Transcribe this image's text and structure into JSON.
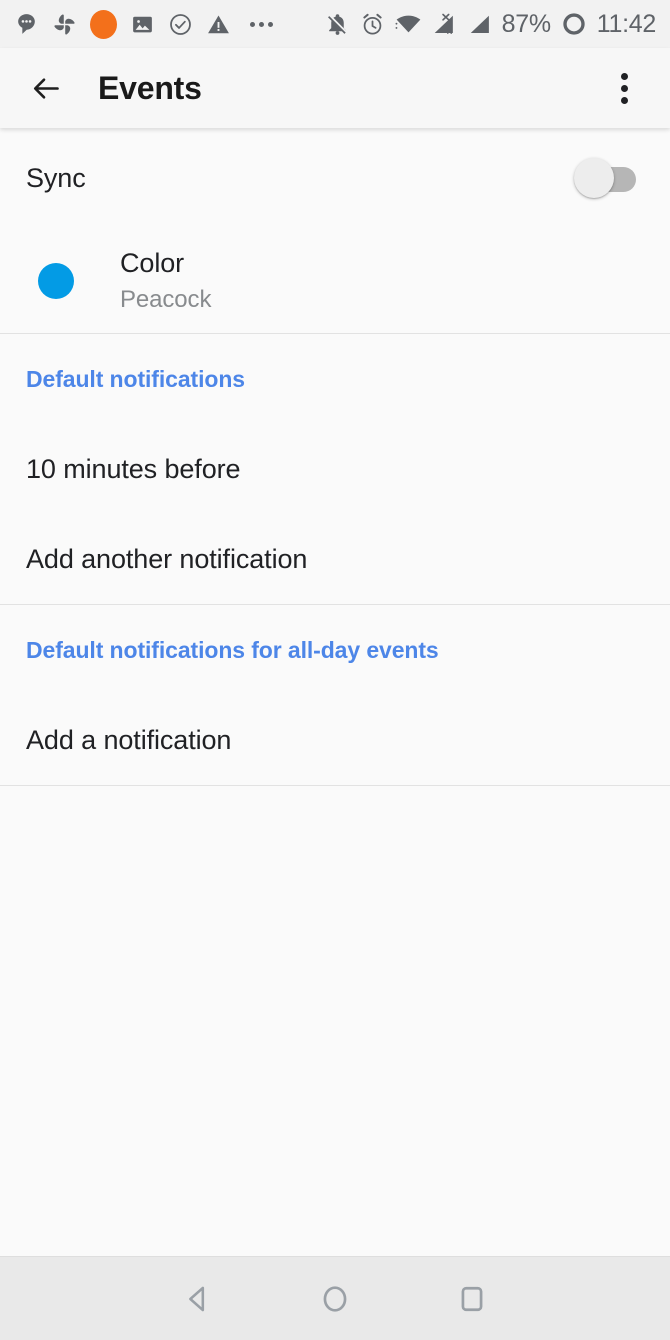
{
  "status_bar": {
    "left_icons": [
      {
        "name": "messages-icon",
        "label": "messages"
      },
      {
        "name": "pinwheel-icon",
        "label": "photos"
      },
      {
        "name": "orange-dot-icon",
        "label": "orange notification"
      },
      {
        "name": "image-icon",
        "label": "screenshot"
      },
      {
        "name": "check-circle-icon",
        "label": "completed"
      },
      {
        "name": "warning-triangle-icon",
        "label": "warning"
      },
      {
        "name": "more-notifications-icon",
        "label": "more"
      }
    ],
    "right_icons": [
      {
        "name": "bell-off-icon",
        "label": "silent"
      },
      {
        "name": "alarm-icon",
        "label": "alarm set"
      },
      {
        "name": "wifi-icon",
        "label": "wifi"
      },
      {
        "name": "mobile-data-off-icon",
        "label": "no data R"
      },
      {
        "name": "signal-icon",
        "label": "signal"
      }
    ],
    "battery_percent": "87%",
    "battery_icon_name": "battery-ring-icon",
    "clock": "11:42"
  },
  "app_bar": {
    "back_icon_name": "back-arrow-icon",
    "title": "Events",
    "overflow_icon_name": "overflow-menu-icon"
  },
  "settings": {
    "sync": {
      "label": "Sync",
      "toggle_state": "off"
    },
    "color": {
      "title": "Color",
      "value": "Peacock",
      "swatch_hex": "#039BE5"
    },
    "notifications_section": {
      "header": "Default notifications",
      "items": [
        "10 minutes before",
        "Add another notification"
      ]
    },
    "allday_section": {
      "header": "Default notifications for all-day events",
      "items": [
        "Add a notification"
      ]
    }
  },
  "nav_bar": {
    "back": "back-nav-button",
    "home": "home-nav-button",
    "recents": "recents-nav-button"
  },
  "theme": {
    "accent_blue": "#4D86E8",
    "peacock": "#039BE5",
    "background": "#FAFAFA",
    "appbar_bg": "#F7F7F7",
    "divider": "#E2E2E2"
  }
}
